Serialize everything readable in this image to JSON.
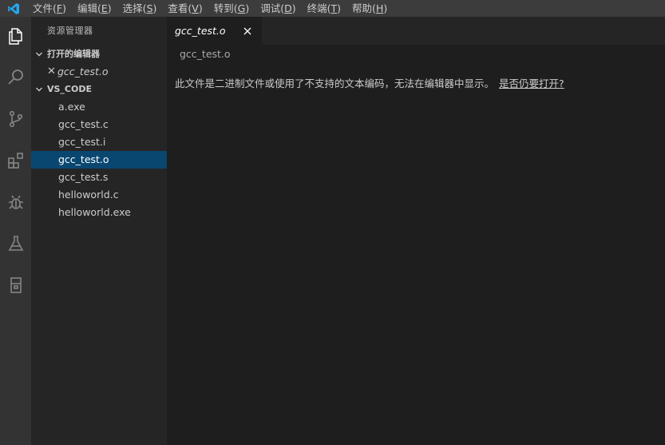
{
  "menubar": {
    "items": [
      {
        "label": "文件(",
        "key": "F",
        "end": ")"
      },
      {
        "label": "编辑(",
        "key": "E",
        "end": ")"
      },
      {
        "label": "选择(",
        "key": "S",
        "end": ")"
      },
      {
        "label": "查看(",
        "key": "V",
        "end": ")"
      },
      {
        "label": "转到(",
        "key": "G",
        "end": ")"
      },
      {
        "label": "调试(",
        "key": "D",
        "end": ")"
      },
      {
        "label": "终端(",
        "key": "T",
        "end": ")"
      },
      {
        "label": "帮助(",
        "key": "H",
        "end": ")"
      }
    ]
  },
  "activity_bar": {
    "icons": [
      "explorer-icon",
      "search-icon",
      "source-control-icon",
      "extensions-icon",
      "debug-icon",
      "test-flask-icon",
      "remote-explorer-icon"
    ]
  },
  "sidebar": {
    "title": "资源管理器",
    "open_editors": {
      "header": "打开的编辑器",
      "items": [
        {
          "name": "gcc_test.o"
        }
      ]
    },
    "folder": {
      "header": "VS_CODE",
      "files": [
        "a.exe",
        "gcc_test.c",
        "gcc_test.i",
        "gcc_test.o",
        "gcc_test.s",
        "helloworld.c",
        "helloworld.exe"
      ],
      "selected": "gcc_test.o"
    }
  },
  "editor": {
    "tab_label": "gcc_test.o",
    "breadcrumb": "gcc_test.o",
    "message": "此文件是二进制文件或使用了不支持的文本编码，无法在编辑器中显示。",
    "open_anyway_link": "是否仍要打开?"
  },
  "colors": {
    "accent": "#0078d4",
    "selection": "#094771",
    "logo": "#23a9f2"
  }
}
